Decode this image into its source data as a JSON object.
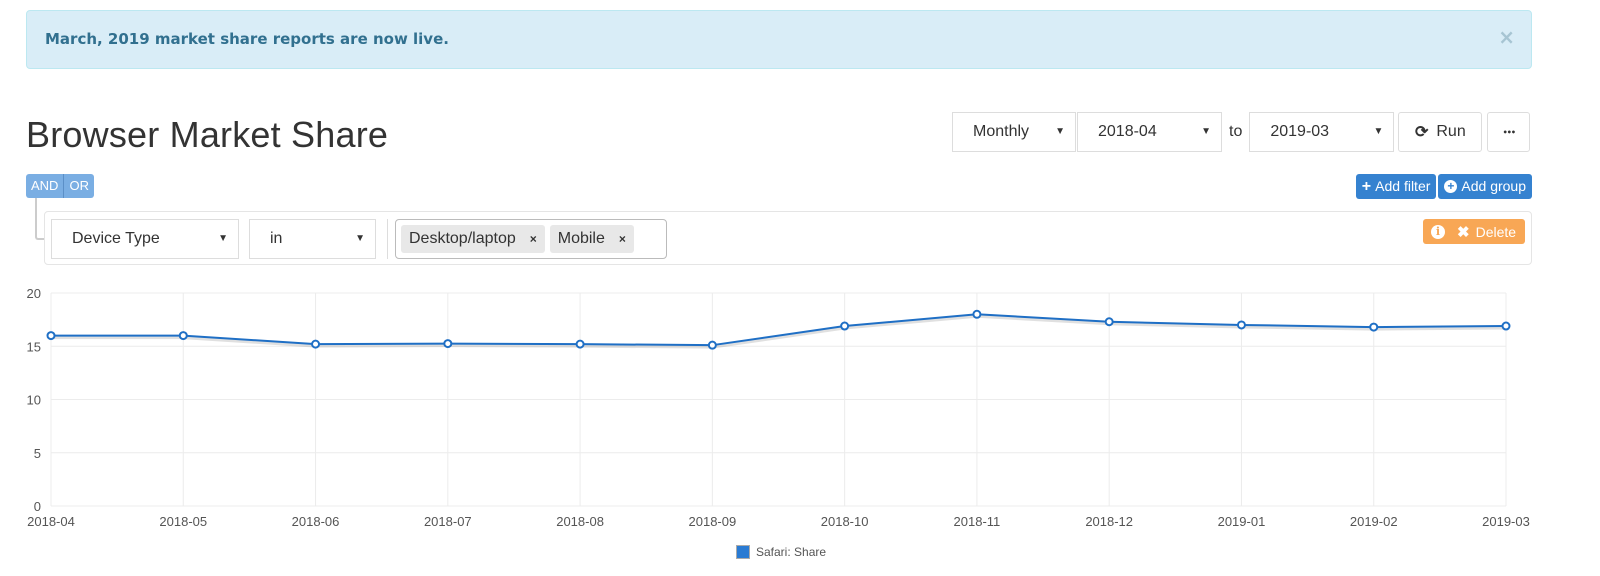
{
  "alert": {
    "message": "March, 2019 market share reports are now live.",
    "close_icon": "×"
  },
  "header": {
    "title": "Browser Market Share"
  },
  "controls": {
    "interval": "Monthly",
    "from": "2018-04",
    "to_label": "to",
    "to": "2019-03",
    "run_label": "Run",
    "run_icon": "⟳",
    "more_icon": "•••",
    "caret": "▼"
  },
  "query": {
    "and_label": "AND",
    "or_label": "OR",
    "add_filter_label": "Add filter",
    "add_group_label": "Add group",
    "plus_icon": "+",
    "rule": {
      "field": "Device Type",
      "operator": "in",
      "values": [
        "Desktop/laptop",
        "Mobile"
      ],
      "remove_icon": "×",
      "info_icon": "i",
      "delete_icon": "✖",
      "delete_label": "Delete"
    }
  },
  "colors": {
    "accent": "#3582d0",
    "series": "#1f6fc5",
    "delete": "#f8a755",
    "alert_bg": "#d9edf7",
    "alert_text": "#31708f"
  },
  "chart_data": {
    "type": "line",
    "title": "",
    "xlabel": "",
    "ylabel": "",
    "categories": [
      "2018-04",
      "2018-05",
      "2018-06",
      "2018-07",
      "2018-08",
      "2018-09",
      "2018-10",
      "2018-11",
      "2018-12",
      "2019-01",
      "2019-02",
      "2019-03"
    ],
    "series": [
      {
        "name": "Safari: Share",
        "values": [
          16.0,
          16.0,
          15.2,
          15.25,
          15.2,
          15.1,
          16.9,
          18.0,
          17.3,
          17.0,
          16.8,
          16.9
        ]
      }
    ],
    "ylim": [
      0,
      20
    ],
    "yticks": [
      0,
      5,
      10,
      15,
      20
    ],
    "grid": true,
    "legend": "bottom-center"
  }
}
